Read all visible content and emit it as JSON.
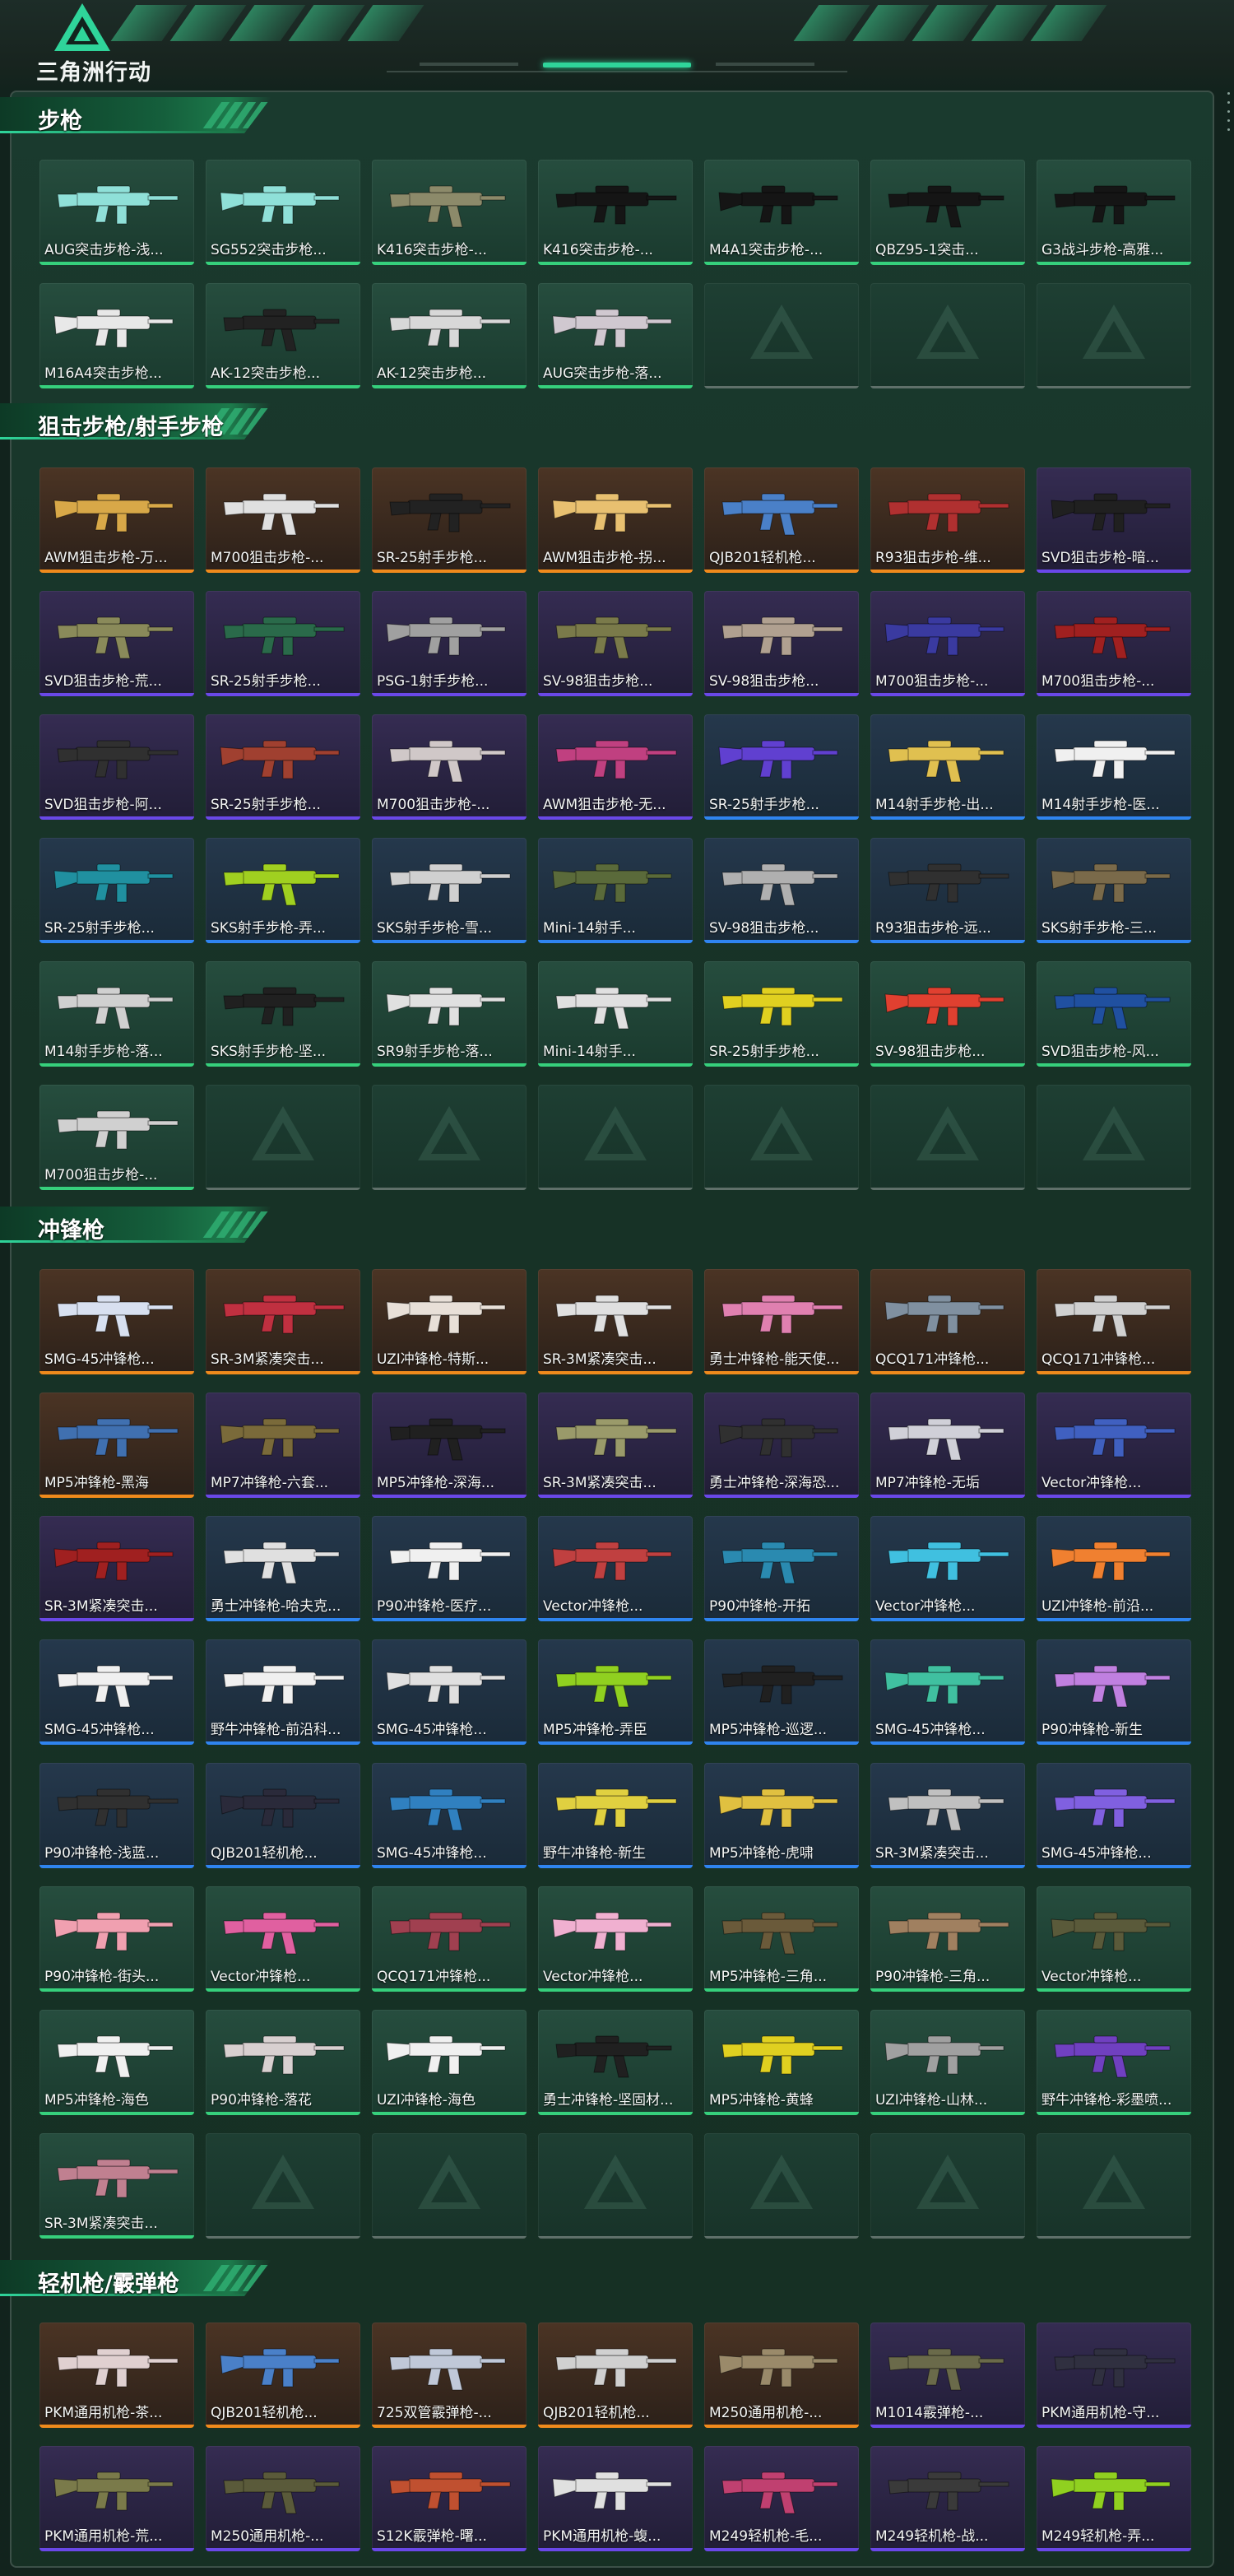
{
  "app": {
    "logo_text": "三角洲行动",
    "logo_icon": "delta-triangle-logo"
  },
  "colors": {
    "accent": "#2fd49a",
    "rarity_gold": "#f08a1c",
    "rarity_purple": "#6a48e8",
    "rarity_blue": "#2f84f0",
    "rarity_green": "#36d07c"
  },
  "categories": [
    {
      "title": "步枪",
      "items": [
        {
          "label": "AUG突击步枪-浅...",
          "rarity": "green",
          "gun_color": "#8fe0d8"
        },
        {
          "label": "SG552突击步枪...",
          "rarity": "green",
          "gun_color": "#8fe0d8"
        },
        {
          "label": "K416突击步枪-...",
          "rarity": "green",
          "gun_color": "#8c8a6a"
        },
        {
          "label": "K416突击步枪-...",
          "rarity": "green",
          "gun_color": "#151515"
        },
        {
          "label": "M4A1突击步枪-...",
          "rarity": "green",
          "gun_color": "#151515"
        },
        {
          "label": "QBZ95-1突击...",
          "rarity": "green",
          "gun_color": "#151515"
        },
        {
          "label": "G3战斗步枪-高雅...",
          "rarity": "green",
          "gun_color": "#151515"
        },
        {
          "label": "M16A4突击步枪...",
          "rarity": "green",
          "gun_color": "#e8e8e8"
        },
        {
          "label": "AK-12突击步枪...",
          "rarity": "green",
          "gun_color": "#222222"
        },
        {
          "label": "AK-12突击步枪...",
          "rarity": "green",
          "gun_color": "#d8d8d8"
        },
        {
          "label": "AUG突击步枪-落...",
          "rarity": "green",
          "gun_color": "#d0c8d0"
        },
        {
          "empty": true
        },
        {
          "empty": true
        },
        {
          "empty": true
        }
      ]
    },
    {
      "title": "狙击步枪/射手步枪",
      "items": [
        {
          "label": "AWM狙击步枪-万...",
          "rarity": "gold",
          "gun_color": "#d8a848"
        },
        {
          "label": "M700狙击步枪-...",
          "rarity": "gold",
          "gun_color": "#e0e0e0"
        },
        {
          "label": "SR-25射手步枪...",
          "rarity": "gold",
          "gun_color": "#222222"
        },
        {
          "label": "AWM狙击步枪-拐...",
          "rarity": "gold",
          "gun_color": "#e8c070"
        },
        {
          "label": "QJB201轻机枪...",
          "rarity": "gold",
          "gun_color": "#4a80c8"
        },
        {
          "label": "R93狙击步枪-维...",
          "rarity": "gold",
          "gun_color": "#b03030"
        },
        {
          "label": "SVD狙击步枪-暗...",
          "rarity": "purple",
          "gun_color": "#202020"
        },
        {
          "label": "SVD狙击步枪-荒...",
          "rarity": "purple",
          "gun_color": "#8a8a5a"
        },
        {
          "label": "SR-25射手步枪...",
          "rarity": "purple",
          "gun_color": "#2a6a4a"
        },
        {
          "label": "PSG-1射手步枪...",
          "rarity": "purple",
          "gun_color": "#a0a0a0"
        },
        {
          "label": "SV-98狙击步枪...",
          "rarity": "purple",
          "gun_color": "#7a7a4a"
        },
        {
          "label": "SV-98狙击步枪...",
          "rarity": "purple",
          "gun_color": "#b0a090"
        },
        {
          "label": "M700狙击步枪-...",
          "rarity": "purple",
          "gun_color": "#3a3aa0"
        },
        {
          "label": "M700狙击步枪-...",
          "rarity": "purple",
          "gun_color": "#a02020"
        },
        {
          "label": "SVD狙击步枪-阿...",
          "rarity": "purple",
          "gun_color": "#303030"
        },
        {
          "label": "SR-25射手步枪...",
          "rarity": "purple",
          "gun_color": "#a04030"
        },
        {
          "label": "M700狙击步枪-...",
          "rarity": "purple",
          "gun_color": "#d0c8c8"
        },
        {
          "label": "AWM狙击步枪-无...",
          "rarity": "purple",
          "gun_color": "#c04080"
        },
        {
          "label": "SR-25射手步枪...",
          "rarity": "blue",
          "gun_color": "#6040d0"
        },
        {
          "label": "M14射手步枪-出...",
          "rarity": "blue",
          "gun_color": "#e0c050"
        },
        {
          "label": "M14射手步枪-医...",
          "rarity": "blue",
          "gun_color": "#f0f0f0"
        },
        {
          "label": "SR-25射手步枪...",
          "rarity": "blue",
          "gun_color": "#2090a0"
        },
        {
          "label": "SKS射手步枪-弄...",
          "rarity": "blue",
          "gun_color": "#a0d020"
        },
        {
          "label": "SKS射手步枪-雪...",
          "rarity": "blue",
          "gun_color": "#d0d0d0"
        },
        {
          "label": "Mini-14射手...",
          "rarity": "blue",
          "gun_color": "#5a6a3a"
        },
        {
          "label": "SV-98狙击步枪...",
          "rarity": "blue",
          "gun_color": "#b0b0b0"
        },
        {
          "label": "R93狙击步枪-远...",
          "rarity": "blue",
          "gun_color": "#303030"
        },
        {
          "label": "SKS射手步枪-三...",
          "rarity": "blue",
          "gun_color": "#7a6a4a"
        },
        {
          "label": "M14射手步枪-落...",
          "rarity": "green",
          "gun_color": "#d0d0d0"
        },
        {
          "label": "SKS射手步枪-坚...",
          "rarity": "green",
          "gun_color": "#202020"
        },
        {
          "label": "SR9射手步枪-落...",
          "rarity": "green",
          "gun_color": "#e0e0e0"
        },
        {
          "label": "Mini-14射手...",
          "rarity": "green",
          "gun_color": "#e0e0e0"
        },
        {
          "label": "SR-25射手步枪...",
          "rarity": "green",
          "gun_color": "#e0d020"
        },
        {
          "label": "SV-98狙击步枪...",
          "rarity": "green",
          "gun_color": "#e04030"
        },
        {
          "label": "SVD狙击步枪-风...",
          "rarity": "green",
          "gun_color": "#2050a0"
        },
        {
          "label": "M700狙击步枪-...",
          "rarity": "green",
          "gun_color": "#d0d0d0"
        },
        {
          "empty": true
        },
        {
          "empty": true
        },
        {
          "empty": true
        },
        {
          "empty": true
        },
        {
          "empty": true
        },
        {
          "empty": true
        }
      ]
    },
    {
      "title": "冲锋枪",
      "items": [
        {
          "label": "SMG-45冲锋枪...",
          "rarity": "gold",
          "gun_color": "#d8e0f0"
        },
        {
          "label": "SR-3M紧凑突击...",
          "rarity": "gold",
          "gun_color": "#c03040"
        },
        {
          "label": "UZI冲锋枪-特斯...",
          "rarity": "gold",
          "gun_color": "#e8e0d8"
        },
        {
          "label": "SR-3M紧凑突击...",
          "rarity": "gold",
          "gun_color": "#e0e0e0"
        },
        {
          "label": "勇士冲锋枪-能天使...",
          "rarity": "gold",
          "gun_color": "#e080b0"
        },
        {
          "label": "QCQ171冲锋枪...",
          "rarity": "gold",
          "gun_color": "#8090a0"
        },
        {
          "label": "QCQ171冲锋枪...",
          "rarity": "gold",
          "gun_color": "#d0d0d0"
        },
        {
          "label": "MP5冲锋枪-黑海",
          "rarity": "gold",
          "gun_color": "#4070b0"
        },
        {
          "label": "MP7冲锋枪-六套...",
          "rarity": "purple",
          "gun_color": "#7a6a3a"
        },
        {
          "label": "MP5冲锋枪-深海...",
          "rarity": "purple",
          "gun_color": "#202020"
        },
        {
          "label": "SR-3M紧凑突击...",
          "rarity": "purple",
          "gun_color": "#9a9a6a"
        },
        {
          "label": "勇士冲锋枪-深海恐...",
          "rarity": "purple",
          "gun_color": "#303030"
        },
        {
          "label": "MP7冲锋枪-无垢",
          "rarity": "purple",
          "gun_color": "#d0d0d8"
        },
        {
          "label": "Vector冲锋枪...",
          "rarity": "purple",
          "gun_color": "#4060c0"
        },
        {
          "label": "SR-3M紧凑突击...",
          "rarity": "purple",
          "gun_color": "#a02020"
        },
        {
          "label": "勇士冲锋枪-哈夫克...",
          "rarity": "blue",
          "gun_color": "#e0e0e0"
        },
        {
          "label": "P90冲锋枪-医疗...",
          "rarity": "blue",
          "gun_color": "#f0f0f0"
        },
        {
          "label": "Vector冲锋枪...",
          "rarity": "blue",
          "gun_color": "#c04040"
        },
        {
          "label": "P90冲锋枪-开拓",
          "rarity": "blue",
          "gun_color": "#2a8ab0"
        },
        {
          "label": "Vector冲锋枪...",
          "rarity": "blue",
          "gun_color": "#40c0e0"
        },
        {
          "label": "UZI冲锋枪-前沿...",
          "rarity": "blue",
          "gun_color": "#f08030"
        },
        {
          "label": "SMG-45冲锋枪...",
          "rarity": "blue",
          "gun_color": "#f0f0f0"
        },
        {
          "label": "野牛冲锋枪-前沿科...",
          "rarity": "blue",
          "gun_color": "#f0f0f0"
        },
        {
          "label": "SMG-45冲锋枪...",
          "rarity": "blue",
          "gun_color": "#e0e0e0"
        },
        {
          "label": "MP5冲锋枪-弄臣",
          "rarity": "blue",
          "gun_color": "#90d020"
        },
        {
          "label": "MP5冲锋枪-巡逻...",
          "rarity": "blue",
          "gun_color": "#202020"
        },
        {
          "label": "SMG-45冲锋枪...",
          "rarity": "blue",
          "gun_color": "#40c0a0"
        },
        {
          "label": "P90冲锋枪-新生",
          "rarity": "blue",
          "gun_color": "#c080e0"
        },
        {
          "label": "P90冲锋枪-浅蓝...",
          "rarity": "blue",
          "gun_color": "#303030"
        },
        {
          "label": "QJB201轻机枪...",
          "rarity": "blue",
          "gun_color": "#2a2a3a"
        },
        {
          "label": "SMG-45冲锋枪...",
          "rarity": "blue",
          "gun_color": "#3080c0"
        },
        {
          "label": "野牛冲锋枪-新生",
          "rarity": "blue",
          "gun_color": "#e0d040"
        },
        {
          "label": "MP5冲锋枪-虎啸",
          "rarity": "blue",
          "gun_color": "#e0c040"
        },
        {
          "label": "SR-3M紧凑突击...",
          "rarity": "blue",
          "gun_color": "#c0c0c0"
        },
        {
          "label": "SMG-45冲锋枪...",
          "rarity": "blue",
          "gun_color": "#8060e0"
        },
        {
          "label": "P90冲锋枪-街头...",
          "rarity": "green",
          "gun_color": "#f0a0b0"
        },
        {
          "label": "Vector冲锋枪...",
          "rarity": "green",
          "gun_color": "#e060a0"
        },
        {
          "label": "QCQ171冲锋枪...",
          "rarity": "green",
          "gun_color": "#a04050"
        },
        {
          "label": "Vector冲锋枪...",
          "rarity": "green",
          "gun_color": "#f0b0d0"
        },
        {
          "label": "MP5冲锋枪-三角...",
          "rarity": "green",
          "gun_color": "#6a5a3a"
        },
        {
          "label": "P90冲锋枪-三角...",
          "rarity": "green",
          "gun_color": "#a08060"
        },
        {
          "label": "Vector冲锋枪...",
          "rarity": "green",
          "gun_color": "#5a5a3a"
        },
        {
          "label": "MP5冲锋枪-海色",
          "rarity": "green",
          "gun_color": "#f0f0f0"
        },
        {
          "label": "P90冲锋枪-落花",
          "rarity": "green",
          "gun_color": "#d8d0d0"
        },
        {
          "label": "UZI冲锋枪-海色",
          "rarity": "green",
          "gun_color": "#f0f0f0"
        },
        {
          "label": "勇士冲锋枪-坚固材...",
          "rarity": "green",
          "gun_color": "#202020"
        },
        {
          "label": "MP5冲锋枪-黄蜂",
          "rarity": "green",
          "gun_color": "#e0d020"
        },
        {
          "label": "UZI冲锋枪-山林...",
          "rarity": "green",
          "gun_color": "#a0a0a0"
        },
        {
          "label": "野牛冲锋枪-彩墨喷...",
          "rarity": "green",
          "gun_color": "#7040c0"
        },
        {
          "label": "SR-3M紧凑突击...",
          "rarity": "green",
          "gun_color": "#c08090"
        },
        {
          "empty": true
        },
        {
          "empty": true
        },
        {
          "empty": true
        },
        {
          "empty": true
        },
        {
          "empty": true
        },
        {
          "empty": true
        }
      ]
    },
    {
      "title": "轻机枪/霰弹枪",
      "items": [
        {
          "label": "PKM通用机枪-茶...",
          "rarity": "gold",
          "gun_color": "#e0d0d0"
        },
        {
          "label": "QJB201轻机枪...",
          "rarity": "gold",
          "gun_color": "#4a80c8"
        },
        {
          "label": "725双管霰弹枪-...",
          "rarity": "gold",
          "gun_color": "#c0c8d8"
        },
        {
          "label": "QJB201轻机枪...",
          "rarity": "gold",
          "gun_color": "#d0d0d0"
        },
        {
          "label": "M250通用机枪-...",
          "rarity": "gold",
          "gun_color": "#9a8a6a"
        },
        {
          "label": "M1014霰弹枪-...",
          "rarity": "purple",
          "gun_color": "#6a6a4a"
        },
        {
          "label": "PKM通用机枪-守...",
          "rarity": "purple",
          "gun_color": "#303040"
        },
        {
          "label": "PKM通用机枪-荒...",
          "rarity": "purple",
          "gun_color": "#7a7a4a"
        },
        {
          "label": "M250通用机枪-...",
          "rarity": "purple",
          "gun_color": "#5a5a3a"
        },
        {
          "label": "S12K霰弹枪-曙...",
          "rarity": "purple",
          "gun_color": "#c05030"
        },
        {
          "label": "PKM通用机枪-蝮...",
          "rarity": "purple",
          "gun_color": "#e0e0e0"
        },
        {
          "label": "M249轻机枪-毛...",
          "rarity": "purple",
          "gun_color": "#c04070"
        },
        {
          "label": "M249轻机枪-战...",
          "rarity": "purple",
          "gun_color": "#3a3a3a"
        },
        {
          "label": "M249轻机枪-弄...",
          "rarity": "purple",
          "gun_color": "#90d020"
        }
      ]
    }
  ]
}
